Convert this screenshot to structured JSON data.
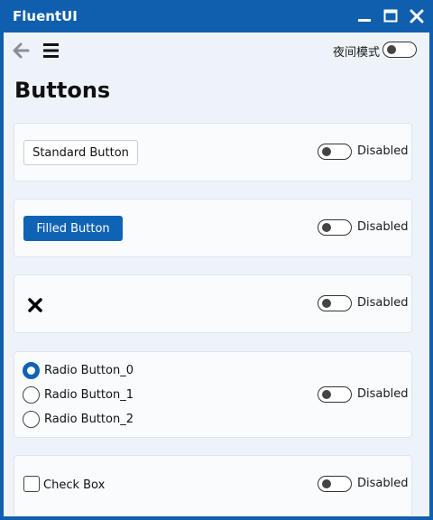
{
  "window": {
    "title": "FluentUI",
    "controls": {
      "minimize_icon": "minimize-icon",
      "maximize_icon": "maximize-icon",
      "close_icon": "close-icon"
    }
  },
  "toolbar": {
    "back_icon": "arrow-left-icon",
    "menu_icon": "hamburger-menu-icon",
    "night_mode_label": "夜间模式",
    "night_mode_on": false
  },
  "page": {
    "title": "Buttons"
  },
  "cards": {
    "standard": {
      "button_label": "Standard Button",
      "toggle_label": "Disabled",
      "toggle_on": false
    },
    "filled": {
      "button_label": "Filled Button",
      "toggle_label": "Disabled",
      "toggle_on": false
    },
    "icon": {
      "icon": "close-x-icon",
      "toggle_label": "Disabled",
      "toggle_on": false
    },
    "radio": {
      "options": [
        "Radio Button_0",
        "Radio Button_1",
        "Radio Button_2"
      ],
      "selected_index": 0,
      "toggle_label": "Disabled",
      "toggle_on": false
    },
    "checkbox": {
      "label": "Check Box",
      "checked": false,
      "toggle_label": "Disabled",
      "toggle_on": false
    }
  },
  "colors": {
    "accent": "#0f63b5",
    "title_bar": "#0f5fae",
    "content_bg": "#eef3f9",
    "card_bg": "#f9fbfd"
  }
}
